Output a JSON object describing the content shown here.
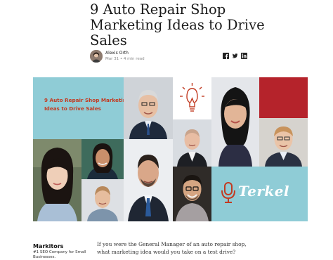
{
  "article": {
    "title": "9 Auto Repair Shop Marketing Ideas to Drive Sales",
    "author": "Alexis Orth",
    "meta": "Mar 31 • 4 min read",
    "intro": "If you were the General Manager of an auto repair shop, what marketing idea would you take on a test drive?"
  },
  "share": {
    "icons": [
      "facebook-icon",
      "twitter-icon",
      "linkedin-icon"
    ]
  },
  "hero": {
    "heading": "9 Auto Repair Shop Marketing Ideas to Drive Sales",
    "brand": "Terkel",
    "colors": {
      "teal": "#8fccd6",
      "red": "#b5232b",
      "accent": "#c23b22"
    }
  },
  "sidebar": {
    "brand": "Markitors",
    "tagline": "#1 SEO Company for Small Businesses."
  }
}
